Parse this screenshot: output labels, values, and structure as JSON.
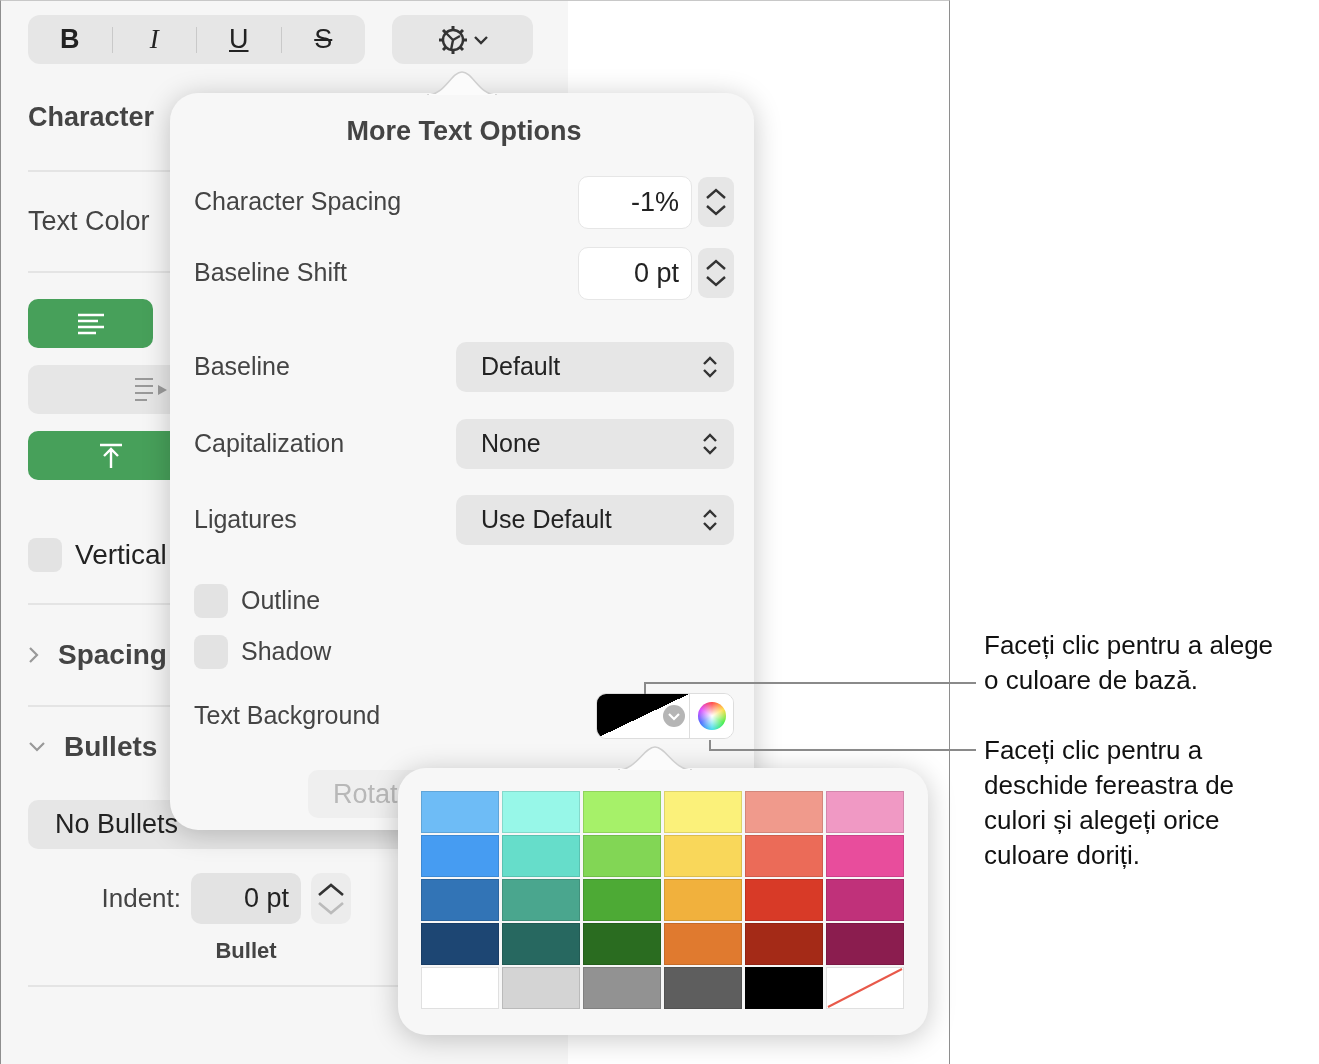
{
  "toolbar": {
    "style_buttons": [
      {
        "label": "B",
        "kind": "bold"
      },
      {
        "label": "I",
        "kind": "italic"
      },
      {
        "label": "U",
        "kind": "underline"
      },
      {
        "label": "S",
        "kind": "strike"
      }
    ]
  },
  "sidebar": {
    "character_styles_label": "Character",
    "text_color_label": "Text Color",
    "align_buttons": [
      {
        "kind": "align-left",
        "selected": true
      },
      {
        "kind": "indent",
        "selected": false
      },
      {
        "kind": "align-top",
        "selected": true
      }
    ],
    "vertical_text": {
      "label": "Vertical",
      "checked": false
    },
    "sections": [
      {
        "label": "Spacing",
        "expanded": false
      },
      {
        "label": "Bullets",
        "expanded": true
      }
    ],
    "bullets_popup": "No Bullets",
    "indent": {
      "label": "Indent:",
      "value": "0 pt",
      "caption": "Bullet"
    }
  },
  "popover": {
    "title": "More Text Options",
    "steppers": [
      {
        "label": "Character Spacing",
        "value": "-1%"
      },
      {
        "label": "Baseline Shift",
        "value": "0 pt"
      }
    ],
    "popups": [
      {
        "label": "Baseline",
        "value": "Default"
      },
      {
        "label": "Capitalization",
        "value": "None"
      },
      {
        "label": "Ligatures",
        "value": "Use Default"
      }
    ],
    "checkboxes": [
      {
        "label": "Outline",
        "checked": false
      },
      {
        "label": "Shadow",
        "checked": false
      }
    ],
    "text_background": {
      "label": "Text Background"
    },
    "faded_button": "Rotat"
  },
  "color_grid": [
    [
      {
        "kind": "color",
        "color": "#6ebcf6"
      },
      {
        "kind": "color",
        "color": "#97f7e8"
      },
      {
        "kind": "color",
        "color": "#a6f169"
      },
      {
        "kind": "color",
        "color": "#fbf17a"
      },
      {
        "kind": "color",
        "color": "#f09a8c"
      },
      {
        "kind": "color",
        "color": "#f099c4"
      }
    ],
    [
      {
        "kind": "color",
        "color": "#469cf2"
      },
      {
        "kind": "color",
        "color": "#66ddca"
      },
      {
        "kind": "color",
        "color": "#82d655"
      },
      {
        "kind": "color",
        "color": "#f9d75a"
      },
      {
        "kind": "color",
        "color": "#eb6b58"
      },
      {
        "kind": "color",
        "color": "#e84d9c"
      }
    ],
    [
      {
        "kind": "color",
        "color": "#3274b6"
      },
      {
        "kind": "color",
        "color": "#4aa68e"
      },
      {
        "kind": "color",
        "color": "#4daa35"
      },
      {
        "kind": "color",
        "color": "#f1b13d"
      },
      {
        "kind": "color",
        "color": "#d83a27"
      },
      {
        "kind": "color",
        "color": "#c0317a"
      }
    ],
    [
      {
        "kind": "color",
        "color": "#1d4673"
      },
      {
        "kind": "color",
        "color": "#276860"
      },
      {
        "kind": "color",
        "color": "#2a6c20"
      },
      {
        "kind": "color",
        "color": "#e07a2f"
      },
      {
        "kind": "color",
        "color": "#a42a17"
      },
      {
        "kind": "color",
        "color": "#8b1d4f"
      }
    ],
    [
      {
        "kind": "color",
        "color": "#ffffff"
      },
      {
        "kind": "color",
        "color": "#d4d4d4"
      },
      {
        "kind": "color",
        "color": "#929292"
      },
      {
        "kind": "color",
        "color": "#5e5e5e"
      },
      {
        "kind": "color",
        "color": "#000000"
      },
      {
        "kind": "none"
      }
    ]
  ],
  "callouts": [
    "Faceți clic pentru a alege\no culoare de bază.",
    "Faceți clic pentru a\ndeschide fereastra de\nculori și alegeți orice\nculoare doriți."
  ]
}
